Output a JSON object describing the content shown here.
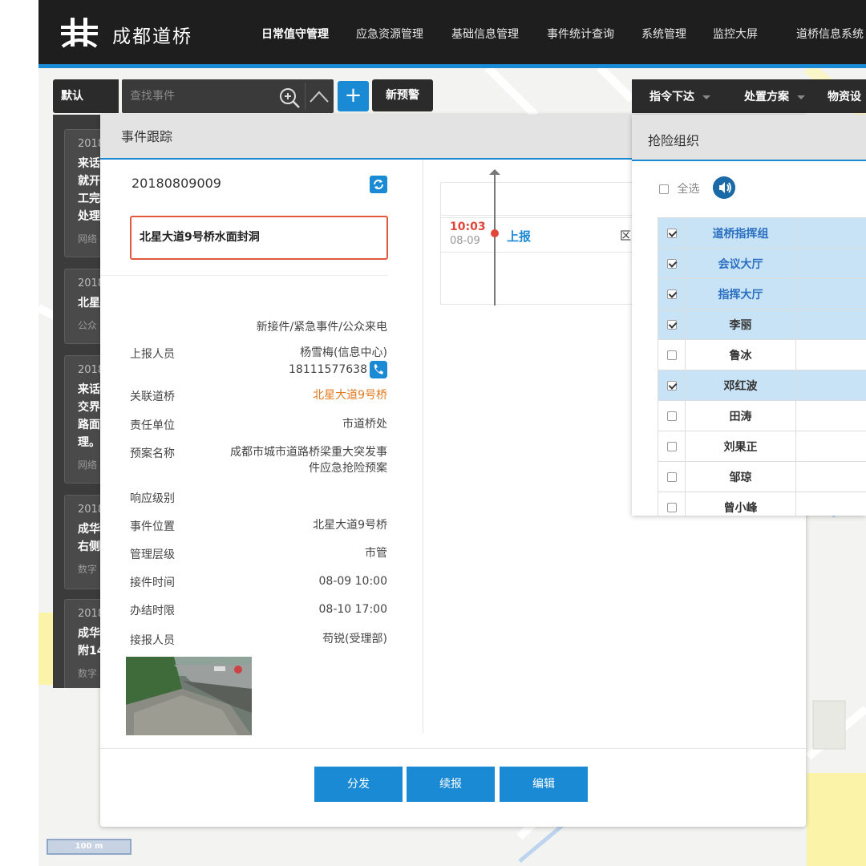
{
  "header": {
    "logo_text": "成都道桥",
    "nav": [
      "日常值守管理",
      "应急资源管理",
      "基础信息管理",
      "事件统计查询",
      "系统管理",
      "监控大屏",
      "道桥信息系统"
    ],
    "active_nav": "日常值守管理"
  },
  "toolbar": {
    "default_label": "默认",
    "search_placeholder": "查找事件",
    "new_alert_label": "新预警"
  },
  "right_toolbar": {
    "items": [
      "指令下达",
      "处置方案",
      "物资设"
    ]
  },
  "event_list": [
    {
      "year": "2018",
      "title": "来话\n就开\n工完\n处理",
      "source": "网络"
    },
    {
      "year": "2018",
      "title": "北星",
      "source": "公众"
    },
    {
      "year": "2018",
      "title": "来话\n交界\n路面\n理。",
      "source": "网络"
    },
    {
      "year": "2018",
      "title": "成华\n右侧",
      "source": "数字"
    },
    {
      "year": "2018",
      "title": "成华\n附14",
      "source": "数字"
    }
  ],
  "event_panel": {
    "title": "事件跟踪",
    "event_id": "20180809009",
    "event_title": "北星大道9号桥水面封洞",
    "event_type": "新接件/紧急事件/公众来电",
    "fields": {
      "reporter_label": "上报人员",
      "reporter_value": "杨雪梅(信息中心)",
      "reporter_phone": "18111577638",
      "bridge_label": "关联道桥",
      "bridge_value": "北星大道9号桥",
      "unit_label": "责任单位",
      "unit_value": "市道桥处",
      "plan_label": "预案名称",
      "plan_value_line1": "成都市城市道路桥梁重大突发事",
      "plan_value_line2": "件应急抢险预案",
      "level_label": "响应级别",
      "level_value": "",
      "location_label": "事件位置",
      "location_value": "北星大道9号桥",
      "mgmt_label": "管理层级",
      "mgmt_value": "市管",
      "recv_time_label": "接件时间",
      "recv_time_value": "08-09 10:00",
      "deadline_label": "办结时限",
      "deadline_value": "08-10 17:00",
      "receiver_label": "接报人员",
      "receiver_value": "苟锐(受理部)"
    },
    "timeline": {
      "time": "10:03",
      "date": "08-09",
      "action": "上报",
      "cut_text": "区"
    },
    "buttons": [
      "分发",
      "续报",
      "编辑"
    ]
  },
  "rescue_panel": {
    "title": "抢险组织",
    "select_all": "全选",
    "rows": [
      {
        "name": "道桥指挥组",
        "checked": true,
        "selected": true,
        "group": true
      },
      {
        "name": "会议大厅",
        "checked": true,
        "selected": true,
        "group": true
      },
      {
        "name": "指挥大厅",
        "checked": true,
        "selected": true,
        "group": true
      },
      {
        "name": "李丽",
        "checked": true,
        "selected": true,
        "group": false
      },
      {
        "name": "鲁冰",
        "checked": false,
        "selected": false,
        "group": false
      },
      {
        "name": "邓红波",
        "checked": true,
        "selected": true,
        "group": false
      },
      {
        "name": "田涛",
        "checked": false,
        "selected": false,
        "group": false
      },
      {
        "name": "刘果正",
        "checked": false,
        "selected": false,
        "group": false
      },
      {
        "name": "邹琼",
        "checked": false,
        "selected": false,
        "group": false
      },
      {
        "name": "曾小峰",
        "checked": false,
        "selected": false,
        "group": false
      }
    ]
  },
  "map": {
    "scale_label": "100 m"
  },
  "colors": {
    "accent": "#1a8ad4",
    "header_bg": "#1e1e1e",
    "alert_border": "#e0593d",
    "link_orange": "#e07a1f",
    "timeline_red": "#e0463a",
    "selected_row": "#c8e2f6"
  }
}
